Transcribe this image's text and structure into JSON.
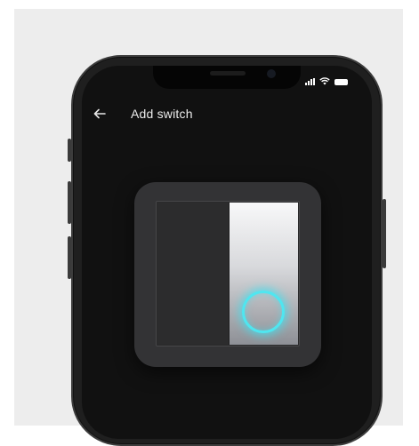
{
  "header": {
    "title": "Add switch",
    "back_icon": "arrow-left-icon"
  },
  "status_bar": {
    "icons": [
      "cellular-signal-icon",
      "wifi-icon",
      "battery-icon"
    ]
  },
  "switch_illustration": {
    "icon": "rocker-switch-illustration",
    "indicator": "touch-ring-icon",
    "colors": {
      "indicator_glow": "#4fe6f0",
      "plate": "#333335",
      "rocker_active": "#e6e7ea"
    }
  },
  "colors": {
    "backdrop": "#ededed",
    "screen": "#111111",
    "title_text": "#ececec"
  }
}
